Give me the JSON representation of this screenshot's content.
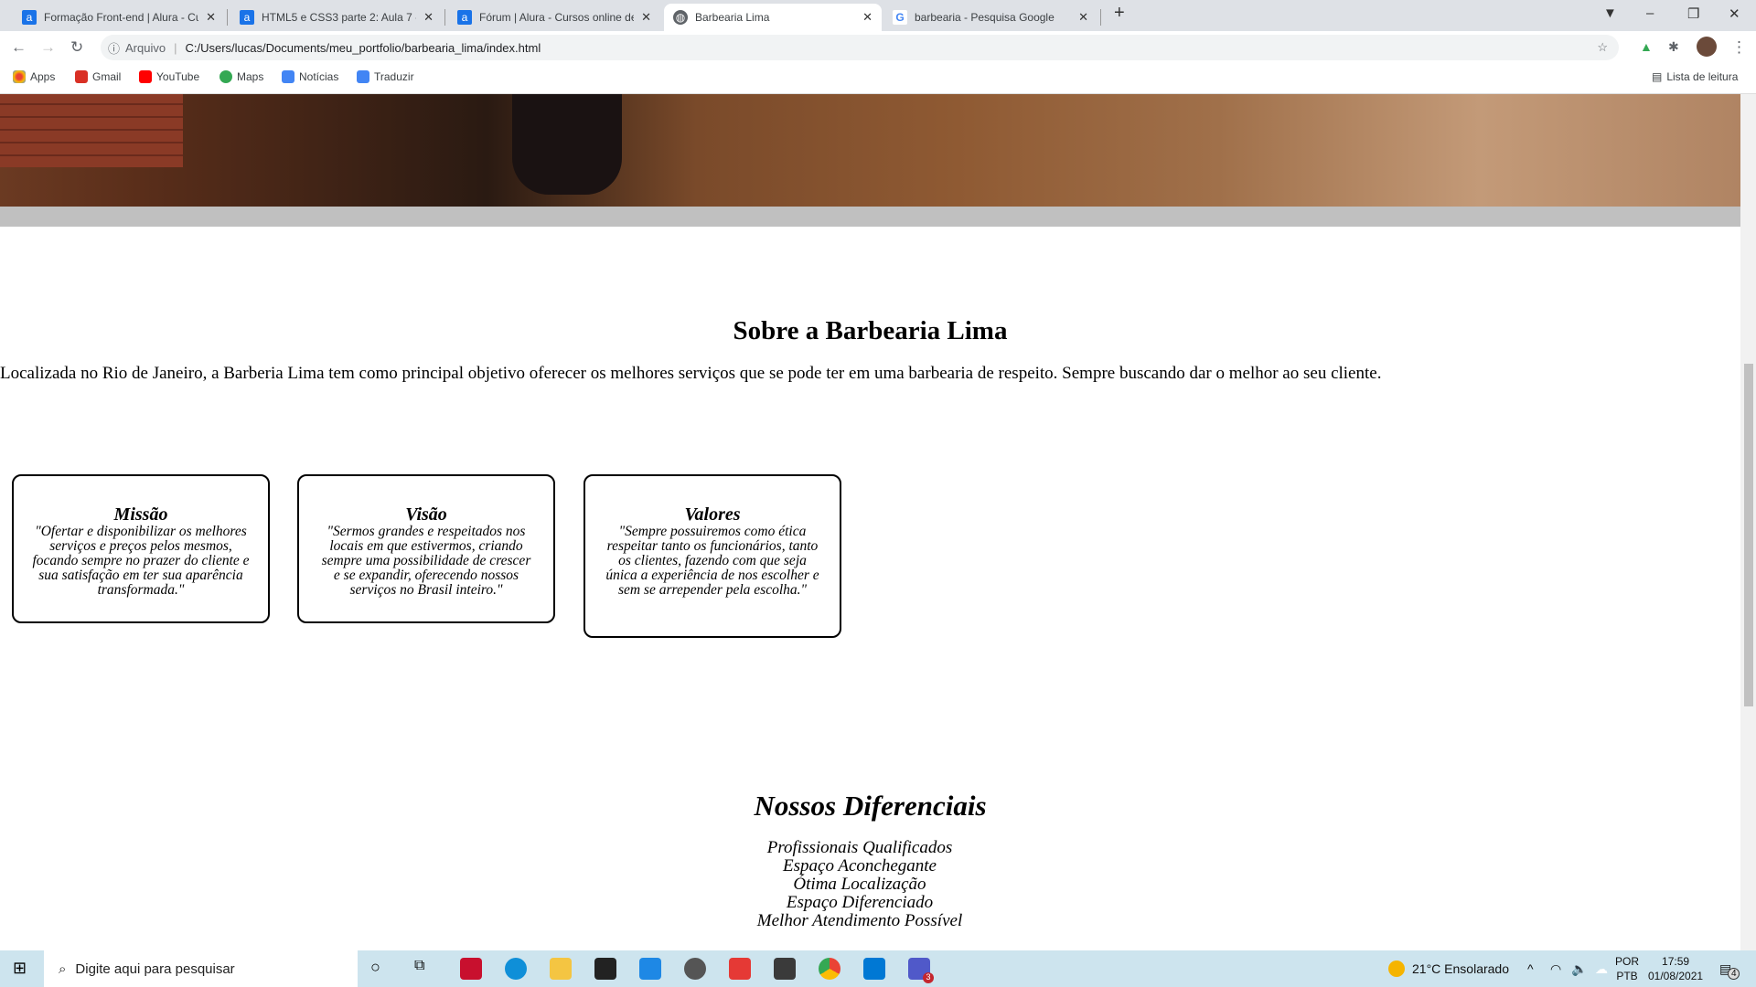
{
  "browser": {
    "tabs": [
      {
        "title": "Formação Front-end | Alura - Cur",
        "icon": "alura-icon"
      },
      {
        "title": "HTML5 e CSS3 parte 2: Aula 7 - A",
        "icon": "alura-icon"
      },
      {
        "title": "Fórum | Alura - Cursos online de",
        "icon": "alura-icon"
      },
      {
        "title": "Barbearia Lima",
        "icon": "globe-icon",
        "active": true
      },
      {
        "title": "barbearia - Pesquisa Google",
        "icon": "google-icon"
      }
    ],
    "new_tab": "+",
    "address": {
      "security_label": "Arquivo",
      "url": "C:/Users/lucas/Documents/meu_portfolio/barbearia_lima/index.html"
    },
    "bookmarks": [
      {
        "label": "Apps",
        "color": "#ea4335"
      },
      {
        "label": "Gmail",
        "color": "#d93025"
      },
      {
        "label": "YouTube",
        "color": "#ff0000"
      },
      {
        "label": "Maps",
        "color": "#34a853"
      },
      {
        "label": "Notícias",
        "color": "#4285f4"
      },
      {
        "label": "Traduzir",
        "color": "#4285f4"
      }
    ],
    "reading_list": "Lista de leitura"
  },
  "page": {
    "about": {
      "title": "Sobre a Barbearia Lima",
      "text": "Localizada no Rio de Janeiro, a Barberia Lima tem como principal objetivo oferecer os melhores serviços que se pode ter em uma barbearia de respeito. Sempre buscando dar o melhor ao seu cliente."
    },
    "cards": [
      {
        "title": "Missão",
        "text": "\"Ofertar e disponibilizar os melhores serviços e preços pelos mesmos, focando sempre no prazer do cliente e sua satisfação em ter sua aparência transformada.\""
      },
      {
        "title": "Visão",
        "text": "\"Sermos grandes e respeitados nos locais em que estivermos, criando sempre uma possibilidade de crescer e se expandir, oferecendo nossos serviços no Brasil inteiro.\""
      },
      {
        "title": "Valores",
        "text": "\"Sempre possuiremos como ética respeitar tanto os funcionários, tanto os clientes, fazendo com que seja única a experiência de nos escolher e sem se arrepender pela escolha.\""
      }
    ],
    "diferenciais": {
      "title": "Nossos Diferenciais",
      "items": [
        "Profissionais Qualificados",
        "Espaço Aconchegante",
        "Ótima Localização",
        "Espaço Diferenciado",
        "Melhor Atendimento Possível"
      ]
    }
  },
  "taskbar": {
    "search_placeholder": "Digite aqui para pesquisar",
    "apps": [
      "mcafee",
      "edge",
      "explorer",
      "store",
      "mail",
      "browser",
      "office",
      "sublime",
      "chrome",
      "vscode",
      "teams"
    ],
    "teams_badge": "3",
    "weather": "21°C  Ensolarado",
    "lang1": "POR",
    "lang2": "PTB",
    "time": "17:59",
    "date": "01/08/2021",
    "notifications": "4"
  }
}
